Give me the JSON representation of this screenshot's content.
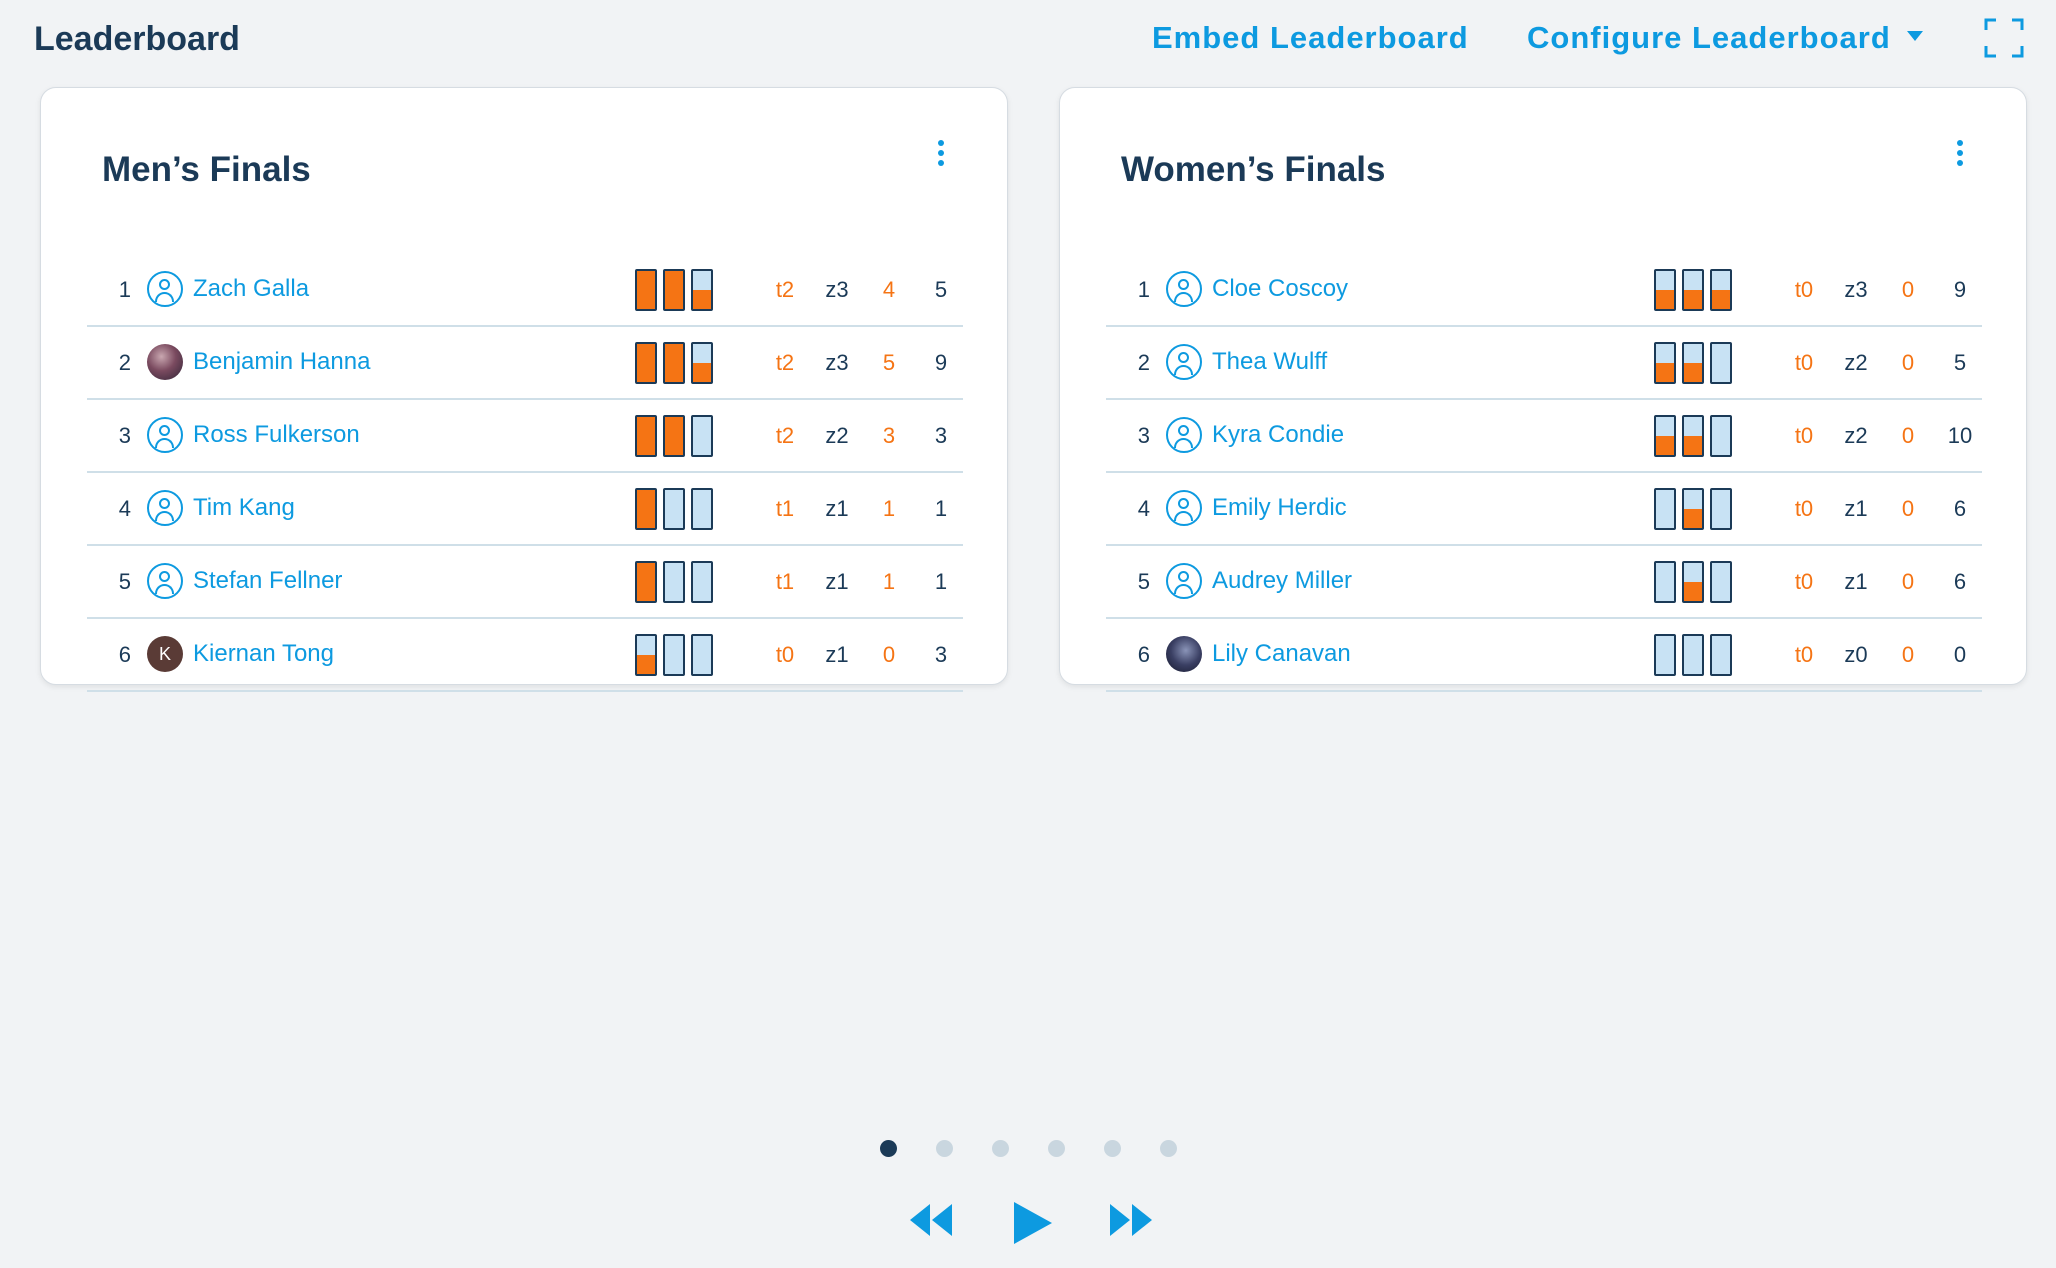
{
  "header": {
    "title": "Leaderboard",
    "embed_label": "Embed Leaderboard",
    "configure_label": "Configure Leaderboard"
  },
  "colors": {
    "accent": "#0d9ae0",
    "orange": "#f57414",
    "navy": "#1b3a57",
    "bar_empty": "#c8e2f4"
  },
  "boards": [
    {
      "title": "Men’s Finals",
      "rows": [
        {
          "rank": "1",
          "name": "Zach Galla",
          "avatar": "outline",
          "tops": "t2",
          "zones": "z3",
          "attempts": "4",
          "points": "5",
          "bar_fill": [
            1,
            1,
            0.5
          ]
        },
        {
          "rank": "2",
          "name": "Benjamin Hanna",
          "avatar": "photo",
          "tops": "t2",
          "zones": "z3",
          "attempts": "5",
          "points": "9",
          "bar_fill": [
            1,
            1,
            0.5
          ]
        },
        {
          "rank": "3",
          "name": "Ross Fulkerson",
          "avatar": "outline",
          "tops": "t2",
          "zones": "z2",
          "attempts": "3",
          "points": "3",
          "bar_fill": [
            1,
            1,
            0
          ]
        },
        {
          "rank": "4",
          "name": "Tim Kang",
          "avatar": "outline",
          "tops": "t1",
          "zones": "z1",
          "attempts": "1",
          "points": "1",
          "bar_fill": [
            1,
            0,
            0
          ]
        },
        {
          "rank": "5",
          "name": "Stefan Fellner",
          "avatar": "outline",
          "tops": "t1",
          "zones": "z1",
          "attempts": "1",
          "points": "1",
          "bar_fill": [
            1,
            0,
            0
          ]
        },
        {
          "rank": "6",
          "name": "Kiernan Tong",
          "avatar": "initial",
          "initial": "K",
          "tops": "t0",
          "zones": "z1",
          "attempts": "0",
          "points": "3",
          "bar_fill": [
            0.5,
            0,
            0
          ]
        }
      ]
    },
    {
      "title": "Women’s Finals",
      "rows": [
        {
          "rank": "1",
          "name": "Cloe Coscoy",
          "avatar": "outline",
          "tops": "t0",
          "zones": "z3",
          "attempts": "0",
          "points": "9",
          "bar_fill": [
            0.5,
            0.5,
            0.5
          ]
        },
        {
          "rank": "2",
          "name": "Thea Wulff",
          "avatar": "outline",
          "tops": "t0",
          "zones": "z2",
          "attempts": "0",
          "points": "5",
          "bar_fill": [
            0.5,
            0.5,
            0
          ]
        },
        {
          "rank": "3",
          "name": "Kyra Condie",
          "avatar": "outline",
          "tops": "t0",
          "zones": "z2",
          "attempts": "0",
          "points": "10",
          "bar_fill": [
            0.5,
            0.5,
            0
          ]
        },
        {
          "rank": "4",
          "name": "Emily Herdic",
          "avatar": "outline",
          "tops": "t0",
          "zones": "z1",
          "attempts": "0",
          "points": "6",
          "bar_fill": [
            0,
            0.5,
            0
          ]
        },
        {
          "rank": "5",
          "name": "Audrey Miller",
          "avatar": "outline",
          "tops": "t0",
          "zones": "z1",
          "attempts": "0",
          "points": "6",
          "bar_fill": [
            0,
            0.5,
            0
          ]
        },
        {
          "rank": "6",
          "name": "Lily Canavan",
          "avatar": "photo2",
          "tops": "t0",
          "zones": "z0",
          "attempts": "0",
          "points": "0",
          "bar_fill": [
            0,
            0,
            0
          ]
        }
      ]
    }
  ],
  "pagination": {
    "count": 6,
    "active": 0
  },
  "controls": {
    "rewind_icon": "rewind-icon",
    "play_icon": "play-icon",
    "forward_icon": "fast-forward-icon"
  }
}
